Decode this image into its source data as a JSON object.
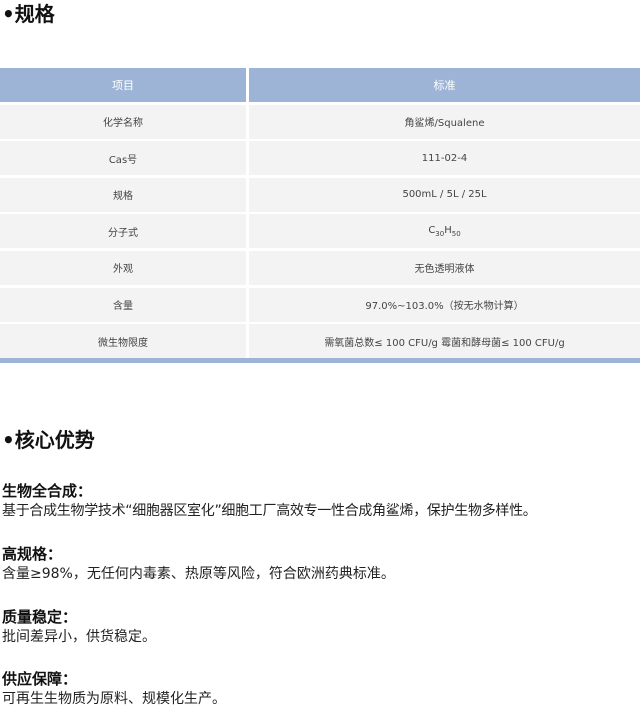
{
  "spec": {
    "title": "•规格",
    "header": {
      "item": "项目",
      "standard": "标准"
    },
    "rows": [
      {
        "item": "化学名称",
        "value": "角鲨烯/Squalene"
      },
      {
        "item": "Cas号",
        "value": "111-02-4"
      },
      {
        "item": "规格",
        "value": "500mL / 5L / 25L"
      },
      {
        "item": "分子式",
        "value": "C30H50"
      },
      {
        "item": "外观",
        "value": "无色透明液体"
      },
      {
        "item": "含量",
        "value": "97.0%~103.0%（按无水物计算）"
      },
      {
        "item": "微生物限度",
        "value": "需氧菌总数≤ 100 CFU/g 霉菌和酵母菌≤ 100 CFU/g"
      }
    ],
    "formula": {
      "c": "C",
      "c_sub": "30",
      "h": "H",
      "h_sub": "50"
    }
  },
  "advantages": {
    "title": "•核心优势",
    "items": [
      {
        "heading": "生物全合成：",
        "text": "基于合成生物学技术“细胞器区室化”细胞工厂高效专一性合成角鲨烯，保护生物多样性。"
      },
      {
        "heading": "高规格：",
        "text": "含量≥98%，无任何内毒素、热原等风险，符合欧洲药典标准。"
      },
      {
        "heading": "质量稳定：",
        "text": "批间差异小，供货稳定。"
      },
      {
        "heading": "供应保障：",
        "text": "可再生生物质为原料、规模化生产。"
      }
    ]
  },
  "colors": {
    "table_header": "#9db4d6",
    "table_cell": "#f3f3f3",
    "text": "#111111"
  }
}
